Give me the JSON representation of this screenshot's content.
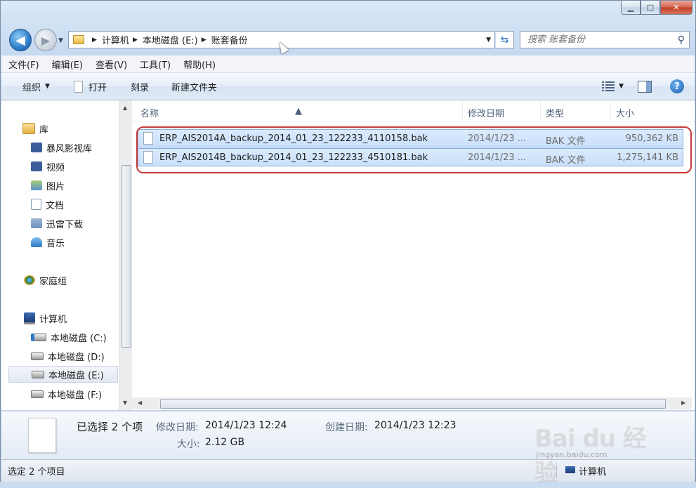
{
  "window": {
    "min_label": "▁",
    "max_label": "□",
    "close_label": "✕"
  },
  "address": {
    "path": [
      "计算机",
      "本地磁盘 (E:)",
      "账套备份"
    ]
  },
  "search": {
    "placeholder": "搜索 账套备份"
  },
  "menu": [
    "文件(F)",
    "编辑(E)",
    "查看(V)",
    "工具(T)",
    "帮助(H)"
  ],
  "toolbar": {
    "organize": "组织",
    "open": "打开",
    "burn": "刻录",
    "new_folder": "新建文件夹"
  },
  "nav": {
    "libraries": "库",
    "library_items": [
      "暴风影视库",
      "视频",
      "图片",
      "文档",
      "迅雷下载",
      "音乐"
    ],
    "homegroup": "家庭组",
    "computer": "计算机",
    "drives": [
      "本地磁盘 (C:)",
      "本地磁盘 (D:)",
      "本地磁盘 (E:)",
      "本地磁盘 (F:)"
    ],
    "selected_drive": "本地磁盘 (E:)"
  },
  "columns": {
    "name": "名称",
    "modified": "修改日期",
    "type": "类型",
    "size": "大小"
  },
  "files": [
    {
      "name": "ERP_AIS2014A_backup_2014_01_23_122233_4110158.bak",
      "modified": "2014/1/23 ...",
      "type": "BAK 文件",
      "size": "950,362 KB"
    },
    {
      "name": "ERP_AIS2014B_backup_2014_01_23_122233_4510181.bak",
      "modified": "2014/1/23 ...",
      "type": "BAK 文件",
      "size": "1,275,141 KB"
    }
  ],
  "details": {
    "selected": "已选择 2 个项",
    "modified_label": "修改日期:",
    "modified_value": "2014/1/23 12:24",
    "created_label": "创建日期:",
    "created_value": "2014/1/23 12:23",
    "size_label": "大小:",
    "size_value": "2.12 GB"
  },
  "status": {
    "left": "选定 2 个项目",
    "right": "计算机"
  },
  "watermark": {
    "text": "Bai du 经验",
    "url": "jingyan.baidu.com"
  }
}
